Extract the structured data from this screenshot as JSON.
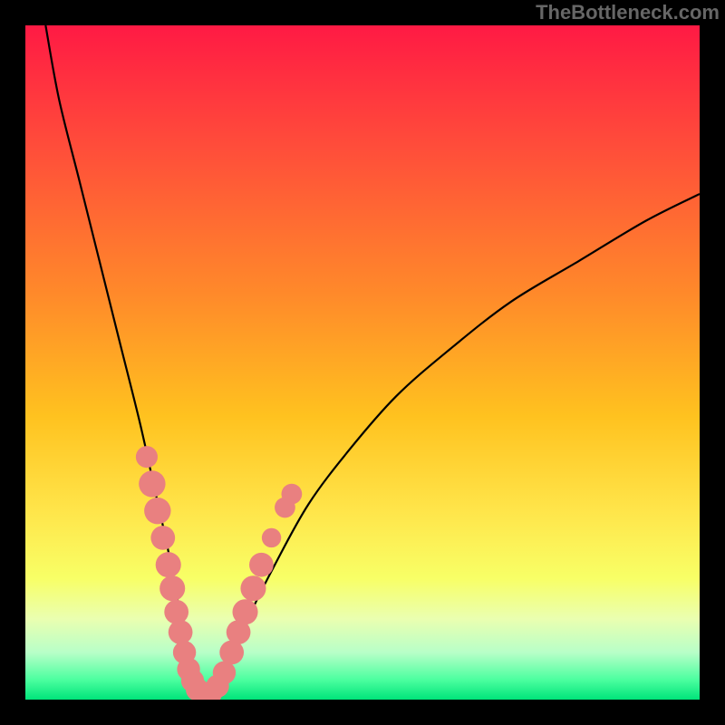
{
  "watermark": "TheBottleneck.com",
  "colors": {
    "page_bg": "#000000",
    "curve": "#000000",
    "marker_fill": "#e98080",
    "marker_stroke": "#c96060",
    "gradient_stops": [
      {
        "offset": 0.0,
        "color": "#ff1a44"
      },
      {
        "offset": 0.18,
        "color": "#ff4d3a"
      },
      {
        "offset": 0.4,
        "color": "#ff8a2a"
      },
      {
        "offset": 0.58,
        "color": "#ffc21f"
      },
      {
        "offset": 0.72,
        "color": "#ffe54a"
      },
      {
        "offset": 0.82,
        "color": "#f8ff66"
      },
      {
        "offset": 0.88,
        "color": "#eaffb0"
      },
      {
        "offset": 0.93,
        "color": "#b8ffc8"
      },
      {
        "offset": 0.97,
        "color": "#4dffa0"
      },
      {
        "offset": 1.0,
        "color": "#00e47a"
      }
    ]
  },
  "chart_data": {
    "type": "line",
    "title": "",
    "xlabel": "",
    "ylabel": "",
    "xlim": [
      0,
      100
    ],
    "ylim": [
      0,
      100
    ],
    "grid": false,
    "series": [
      {
        "name": "bottleneck-curve",
        "x": [
          3,
          5,
          8,
          11,
          14,
          17,
          19,
          21,
          22.5,
          23.5,
          24.5,
          26,
          28,
          30,
          33,
          37,
          42,
          48,
          55,
          63,
          72,
          82,
          92,
          100
        ],
        "values": [
          100,
          89,
          77,
          65,
          53,
          41,
          32,
          23,
          15,
          9,
          4,
          1,
          1,
          5,
          12,
          20,
          29,
          37,
          45,
          52,
          59,
          65,
          71,
          75
        ]
      }
    ],
    "markers": [
      {
        "x": 18.0,
        "y": 36,
        "r": 1.2
      },
      {
        "x": 18.8,
        "y": 32,
        "r": 1.6
      },
      {
        "x": 19.6,
        "y": 28,
        "r": 1.6
      },
      {
        "x": 20.4,
        "y": 24,
        "r": 1.4
      },
      {
        "x": 21.2,
        "y": 20,
        "r": 1.5
      },
      {
        "x": 21.8,
        "y": 16.5,
        "r": 1.5
      },
      {
        "x": 22.4,
        "y": 13,
        "r": 1.4
      },
      {
        "x": 23.0,
        "y": 10,
        "r": 1.4
      },
      {
        "x": 23.6,
        "y": 7,
        "r": 1.3
      },
      {
        "x": 24.2,
        "y": 4.5,
        "r": 1.3
      },
      {
        "x": 24.8,
        "y": 2.8,
        "r": 1.3
      },
      {
        "x": 25.5,
        "y": 1.5,
        "r": 1.3
      },
      {
        "x": 26.5,
        "y": 0.9,
        "r": 1.3
      },
      {
        "x": 27.5,
        "y": 1.0,
        "r": 1.3
      },
      {
        "x": 28.5,
        "y": 2.0,
        "r": 1.3
      },
      {
        "x": 29.5,
        "y": 4.0,
        "r": 1.3
      },
      {
        "x": 30.6,
        "y": 7.0,
        "r": 1.4
      },
      {
        "x": 31.6,
        "y": 10.0,
        "r": 1.4
      },
      {
        "x": 32.6,
        "y": 13.0,
        "r": 1.5
      },
      {
        "x": 33.8,
        "y": 16.5,
        "r": 1.5
      },
      {
        "x": 35.0,
        "y": 20.0,
        "r": 1.4
      },
      {
        "x": 36.5,
        "y": 24.0,
        "r": 1.0
      },
      {
        "x": 38.5,
        "y": 28.5,
        "r": 1.1
      },
      {
        "x": 39.5,
        "y": 30.5,
        "r": 1.1
      }
    ]
  }
}
